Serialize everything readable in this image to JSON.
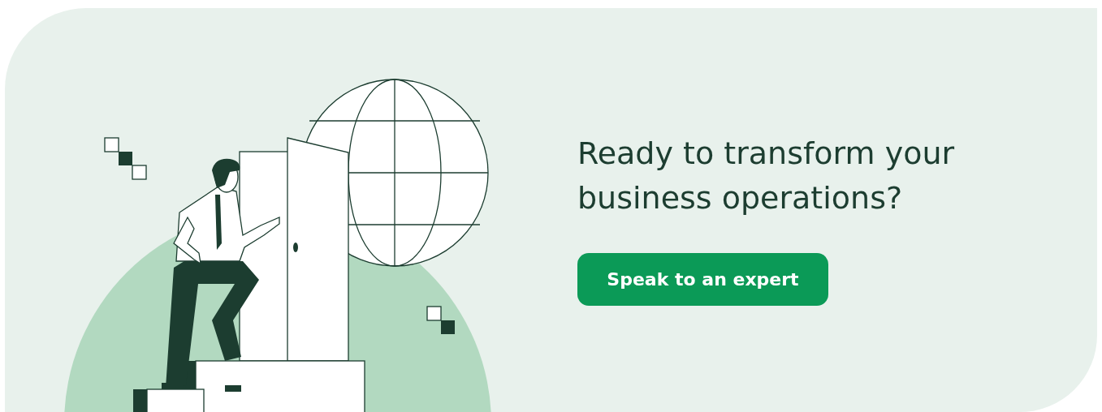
{
  "heading": "Ready to transform your business operations?",
  "button": {
    "label": "Speak to an expert"
  }
}
